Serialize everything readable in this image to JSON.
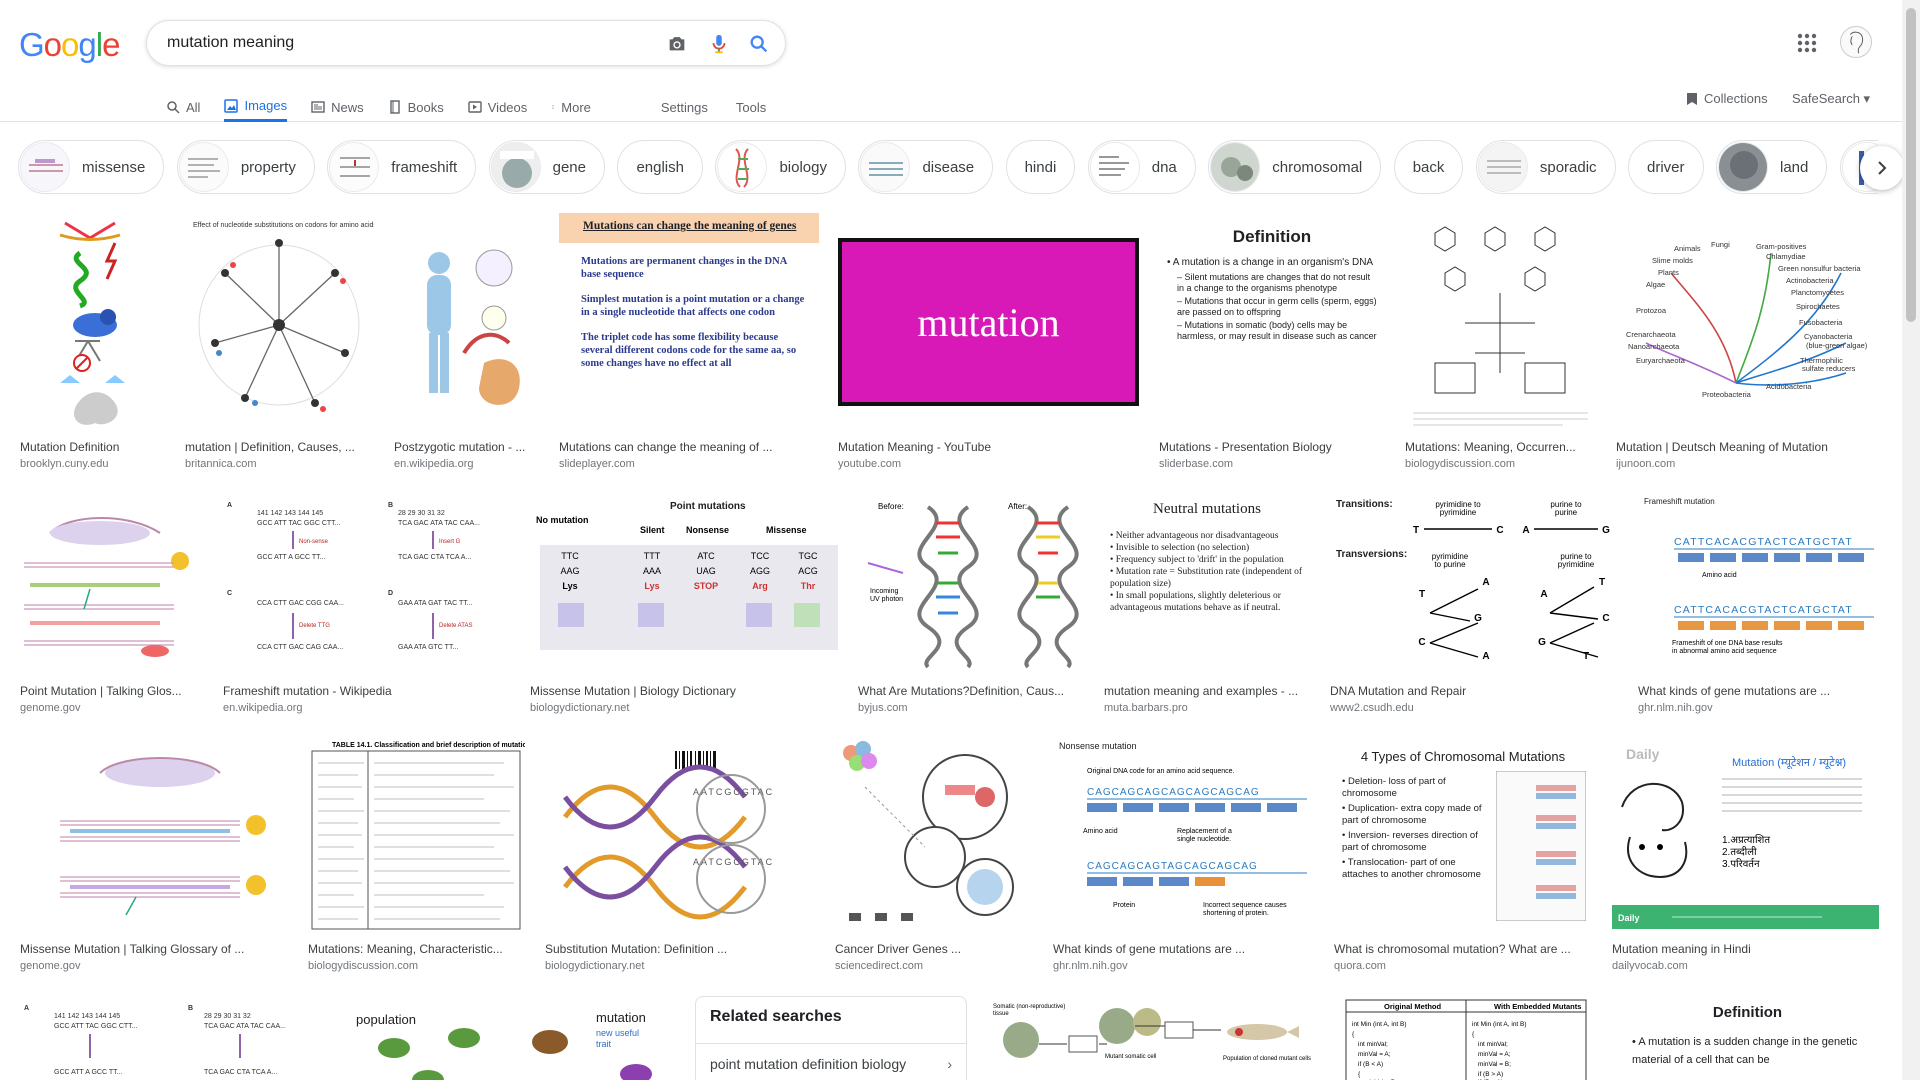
{
  "logo": [
    "G",
    "o",
    "o",
    "g",
    "l",
    "e"
  ],
  "logo_colors": [
    "#4285F4",
    "#EA4335",
    "#FBBC05",
    "#4285F4",
    "#34A853",
    "#EA4335"
  ],
  "search": {
    "value": "mutation meaning"
  },
  "tabs": [
    {
      "label": "All",
      "icon": "search-icon"
    },
    {
      "label": "Images",
      "icon": "image-icon",
      "active": true
    },
    {
      "label": "News",
      "icon": "news-icon"
    },
    {
      "label": "Books",
      "icon": "book-icon"
    },
    {
      "label": "Videos",
      "icon": "video-icon"
    },
    {
      "label": "More",
      "icon": "more-dots-icon"
    }
  ],
  "settings_label": "Settings",
  "tools_label": "Tools",
  "collections_label": "Collections",
  "safesearch_label": "SafeSearch ▾",
  "chips": [
    "missense",
    "property",
    "frameshift",
    "gene",
    "english",
    "biology",
    "disease",
    "hindi",
    "dna",
    "chromosomal",
    "back",
    "sporadic",
    "driver",
    "land",
    "d"
  ],
  "results": [
    {
      "caption": "Mutation Definition",
      "source": "brooklyn.cuny.edu"
    },
    {
      "caption": "mutation | Definition, Causes, ...",
      "source": "britannica.com"
    },
    {
      "caption": "Postzygotic mutation - ...",
      "source": "en.wikipedia.org"
    },
    {
      "caption": "Mutations can change the meaning of ...",
      "source": "slideplayer.com"
    },
    {
      "caption": "Mutation Meaning - YouTube",
      "source": "youtube.com"
    },
    {
      "caption": "Mutations - Presentation Biology",
      "source": "sliderbase.com"
    },
    {
      "caption": "Mutations: Meaning, Occurren...",
      "source": "biologydiscussion.com"
    },
    {
      "caption": "Mutation | Deutsch Meaning of Mutation",
      "source": "ijunoon.com"
    },
    {
      "caption": "Point Mutation | Talking Glos...",
      "source": "genome.gov"
    },
    {
      "caption": "Frameshift mutation - Wikipedia",
      "source": "en.wikipedia.org"
    },
    {
      "caption": "Missense Mutation | Biology Dictionary",
      "source": "biologydictionary.net"
    },
    {
      "caption": "What Are Mutations?Definition, Caus...",
      "source": "byjus.com"
    },
    {
      "caption": "mutation meaning and examples - ...",
      "source": "muta.barbars.pro"
    },
    {
      "caption": "DNA Mutation and Repair",
      "source": "www2.csudh.edu"
    },
    {
      "caption": "What kinds of gene mutations are ...",
      "source": "ghr.nlm.nih.gov"
    },
    {
      "caption": "Missense Mutation | Talking Glossary of ...",
      "source": "genome.gov"
    },
    {
      "caption": "Mutations: Meaning, Characteristic...",
      "source": "biologydiscussion.com"
    },
    {
      "caption": "Substitution Mutation: Definition ...",
      "source": "biologydictionary.net"
    },
    {
      "caption": "Cancer Driver Genes ...",
      "source": "sciencedirect.com"
    },
    {
      "caption": "What kinds of gene mutations are ...",
      "source": "ghr.nlm.nih.gov"
    },
    {
      "caption": "What is chromosomal mutation? What are ...",
      "source": "quora.com"
    },
    {
      "caption": "Mutation meaning in Hindi",
      "source": "dailyvocab.com"
    }
  ],
  "thumb_text": {
    "slideplayer_title": "Mutations can change the meaning of genes",
    "slideplayer_b1": "Mutations are permanent changes in the DNA base sequence",
    "slideplayer_b2": "Simplest mutation is a point mutation or a change in a single nucleotide that affects one codon",
    "slideplayer_b3": "The triplet code has some flexibility because several different codons code for the same aa, so some changes have no effect at all",
    "youtube_word": "mutation",
    "def_title": "Definition",
    "def_b1": "A mutation is a change in an organism's DNA",
    "def_b2": "Silent mutations are changes that do not result in a change to the organisms phenotype",
    "def_b3": "Mutations that occur in germ cells (sperm, eggs) are passed on to offspring",
    "def_b4": "Mutations in somatic (body) cells may be harmless, or may result in disease such as cancer",
    "neutral_title": "Neutral mutations",
    "neutral_b1": "Neither advantageous nor disadvantageous",
    "neutral_b2": "Invisible to selection (no selection)",
    "neutral_b3": "Frequency subject to 'drift' in the population",
    "neutral_b4": "Mutation rate = Substitution rate (independent of population size)",
    "neutral_b5": "In small populations, slightly deleterious or advantageous mutations behave as if neutral.",
    "chrom_title": "4 Types of Chromosomal Mutations",
    "chrom_b1": "Deletion- loss of part of chromosome",
    "chrom_b2": "Duplication- extra copy made of part of chromosome",
    "chrom_b3": "Inversion- reverses direction of part of chromosome",
    "chrom_b4": "Translocation- part of one attaches to another chromosome",
    "missense_table_header": "Point mutations",
    "repair_transitions": "Transitions:",
    "repair_transversions": "Transversions:",
    "frameshift_label": "Frameshift mutation",
    "nonsense_label": "Nonsense mutation",
    "hindi_word": "Mutation (म्यूटेशन / म्यूटेश्न)",
    "bottom_def_title": "Definition",
    "bottom_def_b1": "A mutation is a sudden change in the genetic material of a cell that can be",
    "population_word": "population",
    "mutation_word": "mutation",
    "new_useful_trait": "new useful trait"
  },
  "related": {
    "title": "Related searches",
    "item": "point mutation definition biology"
  }
}
